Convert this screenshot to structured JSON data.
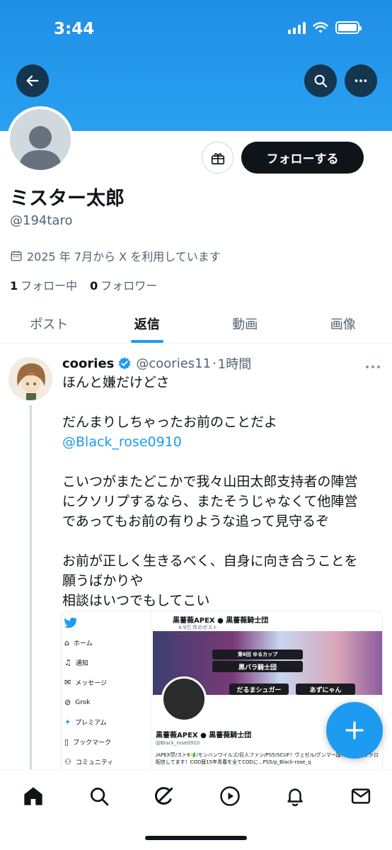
{
  "status_bar": {
    "time": "3:44",
    "battery_level": 1.0
  },
  "header": {
    "banner_color": "#1f8fe6",
    "back_icon": "arrow-left-icon",
    "search_icon": "search-icon",
    "more_icon": "more-icon"
  },
  "profile": {
    "display_name": "ミスター太郎",
    "handle": "@194taro",
    "joined": "2025 年 7月から X を利用しています",
    "following_count": "1",
    "following_label": "フォロー中",
    "followers_count": "0",
    "followers_label": "フォロワー",
    "follow_button": "フォローする"
  },
  "tabs": [
    {
      "label": "ポスト",
      "active": false
    },
    {
      "label": "返信",
      "active": true
    },
    {
      "label": "動画",
      "active": false
    },
    {
      "label": "画像",
      "active": false
    }
  ],
  "post": {
    "author_name": "coories",
    "author_handle": "@coories11",
    "time": "1時間",
    "verified": true,
    "lines": [
      "ほんと嫌だけどさ",
      "",
      "だんまりしちゃったお前のことだよ",
      "@Black_rose0910",
      "",
      "こいつがまたどこかで我々山田太郎支持者の陣営",
      "にクソリプするなら、またそうじゃなくて他陣営",
      "であってもお前の有りような追って見守るぞ",
      "",
      "お前が正しく生きるべく、自身に向き合うことを",
      "願うばかりや",
      "相談はいつでもしてこい"
    ],
    "mention": "@Black_rose0910",
    "media": {
      "nav_items": [
        "ホーム",
        "通知",
        "メッセージ",
        "Grok",
        "プレミアム",
        "ブックマーク",
        "コミュニティ"
      ],
      "profile_title": "黒薔薇APEX ● 黒薔薇騎士団",
      "post_count": "4.9万 件のポスト",
      "banner_label_1": "黒バラ騎士団",
      "banner_tag": "第6回 ゆるカップ",
      "team_1": "だるまシュガー",
      "team_2": "あずにゃん",
      "profile_name": "黒薔薇APEX ● 黒薔薇騎士団",
      "profile_handle": "@Black_rose0910",
      "profile_bio": "/APEX😈/スト6🔰/モンハンワイルズ/巨人ファン/PS5/SCUF！ヴェゼル/グンマー国！APEX、ヴァロ配信してます！COD歴15年青春を全てCODに...PS5/p_Black-rose_q"
    }
  },
  "bottom_nav": [
    "home-icon",
    "search-icon",
    "grok-icon",
    "video-icon",
    "bell-icon",
    "mail-icon"
  ],
  "accent_color": "#1d9bf0"
}
